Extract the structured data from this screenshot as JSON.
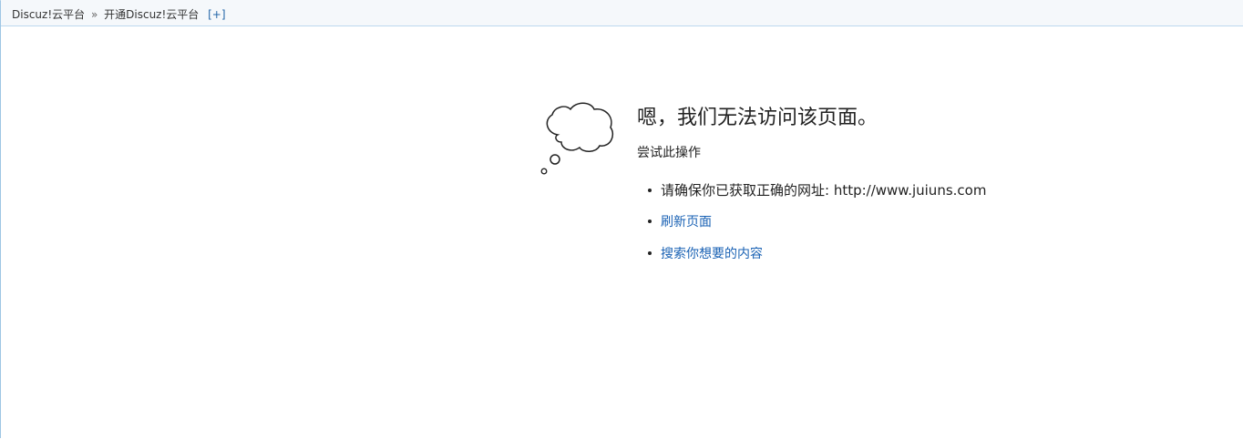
{
  "breadcrumb": {
    "item1": "Discuz!云平台",
    "separator": "»",
    "item2": "开通Discuz!云平台",
    "plus": "[+]"
  },
  "error": {
    "icon": "thought-cloud-icon",
    "heading": "嗯，我们无法访问该页面。",
    "subheading": "尝试此操作",
    "items": [
      {
        "text": "请确保你已获取正确的网址: http://www.juiuns.com"
      },
      {
        "text": "刷新页面"
      },
      {
        "text": "搜索你想要的内容"
      }
    ]
  },
  "colors": {
    "link": "#1a62b4",
    "topbar_bg": "#f5f8fb",
    "topbar_border": "#bcd8ee"
  }
}
